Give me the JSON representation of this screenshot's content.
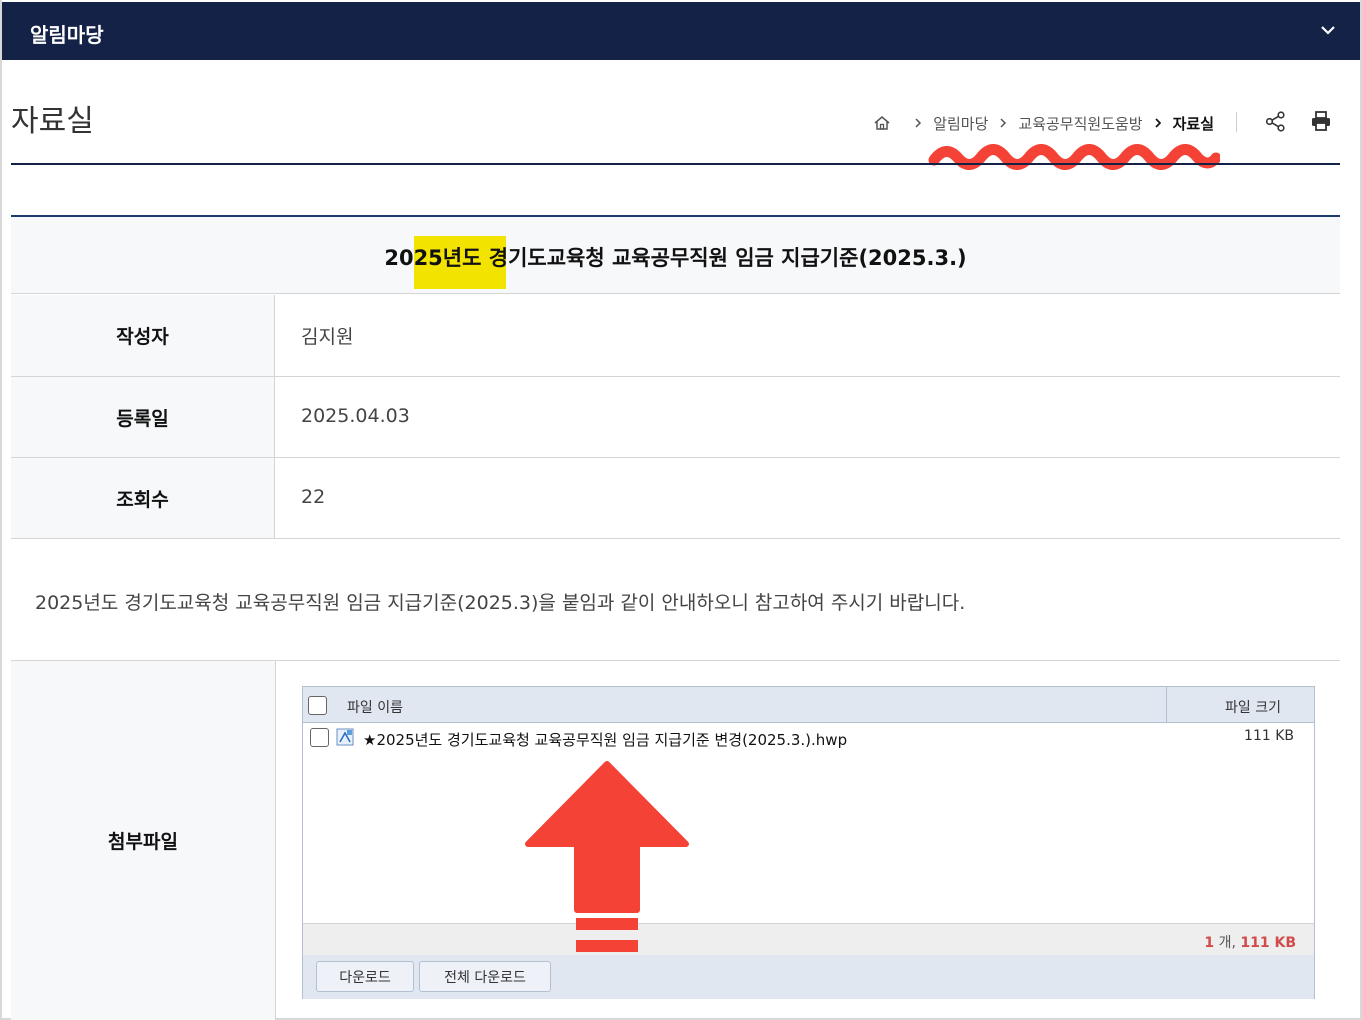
{
  "topbar": {
    "title": "알림마당",
    "toggle_icon": "chevron-down-icon"
  },
  "page": {
    "title": "자료실"
  },
  "breadcrumb": {
    "home_icon": "home-icon",
    "items": [
      "알림마당",
      "교육공무직원도움방",
      "자료실"
    ]
  },
  "tools": {
    "share_icon": "share-icon",
    "print_icon": "print-icon"
  },
  "post": {
    "title_highlight": "2025년도",
    "title_rest": " 경기도교육청 교육공무직원 임금 지급기준(2025.3.)",
    "author_label": "작성자",
    "author": "김지원",
    "date_label": "등록일",
    "date": "2025.04.03",
    "views_label": "조회수",
    "views": "22",
    "content": "2025년도 경기도교육청 교육공무직원 임금 지급기준(2025.3)을 붙임과 같이 안내하오니 참고하여 주시기 바랍니다.",
    "attachment_label": "첨부파일"
  },
  "files": {
    "col_name": "파일 이름",
    "col_size": "파일 크기",
    "items": [
      {
        "name": "★2025년도 경기도교육청 교육공무직원 임금 지급기준 변경(2025.3.).hwp",
        "size": "111 KB",
        "icon": "hwp-file-icon"
      }
    ],
    "summary_count": "1",
    "summary_count_unit": " 개, ",
    "summary_size": "111 KB",
    "download_label": "다운로드",
    "download_all_label": "전체 다운로드"
  },
  "colors": {
    "header_bg": "#132246",
    "highlight": "#f3e300",
    "annotation_red": "#f44336",
    "summary_red": "#d24b4b"
  }
}
